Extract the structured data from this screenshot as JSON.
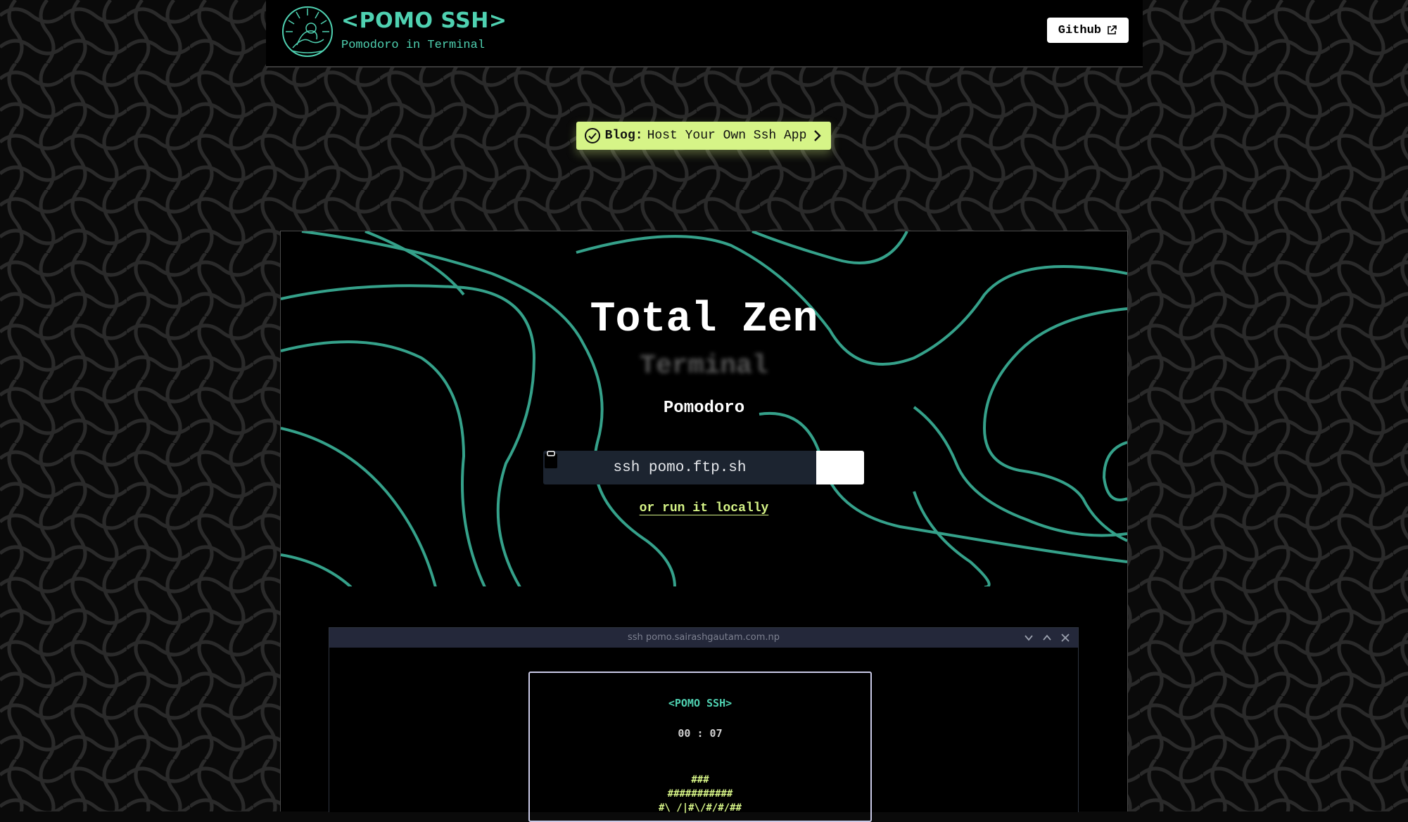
{
  "header": {
    "brand_title": "<POMO SSH>",
    "brand_subtitle": "Pomodoro in Terminal",
    "github_label": "Github"
  },
  "banner": {
    "prefix": "Blog:",
    "text": "Host Your Own Ssh App"
  },
  "hero": {
    "title": "Total Zen",
    "ghost_word": "Terminal",
    "subtitle": "Pomodoro",
    "command": "ssh pomo.ftp.sh",
    "run_locally": "or run it locally"
  },
  "terminal": {
    "window_title": "ssh pomo.sairashgautam.com.np",
    "app_title": "<POMO SSH>",
    "timer": "00 : 07",
    "art_line1": "###",
    "art_line2": "###########",
    "art_line3": "#\\ /|#\\/#/#/##"
  },
  "colors": {
    "accent_teal": "#4fd1b1",
    "accent_lime": "#d6f487",
    "background": "#0a0a0a",
    "command_bg": "#1c2430"
  },
  "icons": [
    "logo-icon",
    "external-link-icon",
    "check-circle-icon",
    "chevron-right-icon",
    "clipboard-icon",
    "chevron-down-icon",
    "chevron-up-icon",
    "close-icon"
  ]
}
